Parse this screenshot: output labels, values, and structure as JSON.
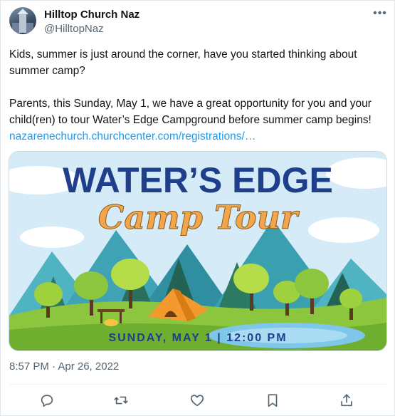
{
  "author": {
    "display_name": "Hilltop Church Naz",
    "handle": "@HilltopNaz"
  },
  "more_icon": "more-horizontal-icon",
  "tweet": {
    "line1": "Kids, summer is just around the corner, have you started thinking about summer camp?",
    "line2_prefix": "Parents, this Sunday, May 1, we have a great opportunity for you and your child(ren) to tour Water’s Edge Campground before summer camp begins! ",
    "link": "nazarenechurch.churchcenter.com/registrations/…"
  },
  "media": {
    "title": "WATER’S EDGE",
    "script_title": "Camp Tour",
    "date_line": "SUNDAY, MAY 1 | 12:00 PM",
    "colors": {
      "sky": "#cfe9f7",
      "title_blue": "#1f3f8a",
      "script_orange": "#f2a54a",
      "tent": "#f29a2e",
      "grass": "#8cc63f",
      "water": "#7fc7e8"
    }
  },
  "timestamp": "8:57 PM · Apr 26, 2022",
  "actions": {
    "reply": "reply-icon",
    "retweet": "retweet-icon",
    "like": "heart-icon",
    "bookmark": "bookmark-icon",
    "share": "share-icon"
  }
}
